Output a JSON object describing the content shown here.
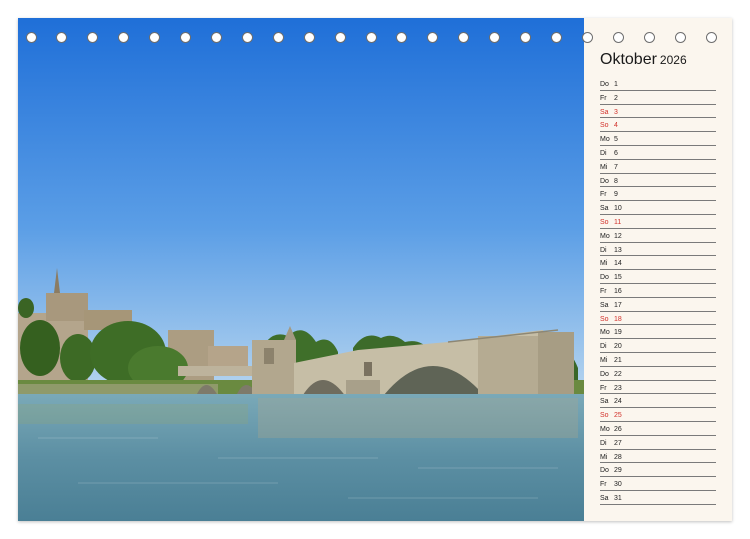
{
  "calendar": {
    "month": "Oktober",
    "year": "2026",
    "days": [
      {
        "wd": "Do",
        "num": "1",
        "sun": false
      },
      {
        "wd": "Fr",
        "num": "2",
        "sun": false
      },
      {
        "wd": "Sa",
        "num": "3",
        "sun": true
      },
      {
        "wd": "So",
        "num": "4",
        "sun": true
      },
      {
        "wd": "Mo",
        "num": "5",
        "sun": false
      },
      {
        "wd": "Di",
        "num": "6",
        "sun": false
      },
      {
        "wd": "Mi",
        "num": "7",
        "sun": false
      },
      {
        "wd": "Do",
        "num": "8",
        "sun": false
      },
      {
        "wd": "Fr",
        "num": "9",
        "sun": false
      },
      {
        "wd": "Sa",
        "num": "10",
        "sun": false
      },
      {
        "wd": "So",
        "num": "11",
        "sun": true
      },
      {
        "wd": "Mo",
        "num": "12",
        "sun": false
      },
      {
        "wd": "Di",
        "num": "13",
        "sun": false
      },
      {
        "wd": "Mi",
        "num": "14",
        "sun": false
      },
      {
        "wd": "Do",
        "num": "15",
        "sun": false
      },
      {
        "wd": "Fr",
        "num": "16",
        "sun": false
      },
      {
        "wd": "Sa",
        "num": "17",
        "sun": false
      },
      {
        "wd": "So",
        "num": "18",
        "sun": true
      },
      {
        "wd": "Mo",
        "num": "19",
        "sun": false
      },
      {
        "wd": "Di",
        "num": "20",
        "sun": false
      },
      {
        "wd": "Mi",
        "num": "21",
        "sun": false
      },
      {
        "wd": "Do",
        "num": "22",
        "sun": false
      },
      {
        "wd": "Fr",
        "num": "23",
        "sun": false
      },
      {
        "wd": "Sa",
        "num": "24",
        "sun": false
      },
      {
        "wd": "So",
        "num": "25",
        "sun": true
      },
      {
        "wd": "Mo",
        "num": "26",
        "sun": false
      },
      {
        "wd": "Di",
        "num": "27",
        "sun": false
      },
      {
        "wd": "Mi",
        "num": "28",
        "sun": false
      },
      {
        "wd": "Do",
        "num": "29",
        "sun": false
      },
      {
        "wd": "Fr",
        "num": "30",
        "sun": false
      },
      {
        "wd": "Sa",
        "num": "31",
        "sun": false
      }
    ]
  },
  "colors": {
    "sky_top": "#1f6fd8",
    "sky_bottom": "#a9cdee",
    "water": "#5f93a8",
    "sunday_red": "#d2312a",
    "panel_bg": "#fbf6ee"
  },
  "binding": {
    "ring_count": 23
  }
}
